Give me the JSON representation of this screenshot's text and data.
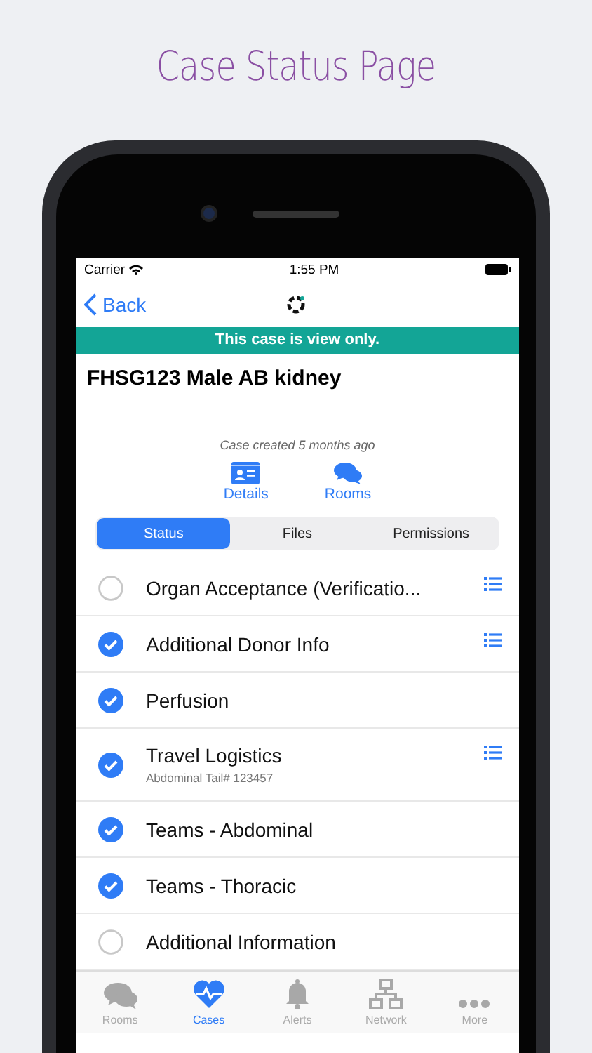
{
  "headline": "Case Status Page",
  "status_bar": {
    "carrier": "Carrier",
    "time": "1:55 PM"
  },
  "nav": {
    "back": "Back"
  },
  "banner": "This case is view only.",
  "case_title": "FHSG123 Male AB kidney",
  "created": "Case created 5 months ago",
  "actions": [
    {
      "label": "Details",
      "kind": "details"
    },
    {
      "label": "Rooms",
      "kind": "rooms"
    }
  ],
  "tabs": [
    {
      "label": "Status",
      "selected": true
    },
    {
      "label": "Files",
      "selected": false
    },
    {
      "label": "Permissions",
      "selected": false
    }
  ],
  "items": [
    {
      "label": "Organ Acceptance (Verificatio...",
      "checked": false,
      "list_button": true
    },
    {
      "label": "Additional Donor Info",
      "checked": true,
      "list_button": true
    },
    {
      "label": "Perfusion",
      "checked": true,
      "list_button": false
    },
    {
      "label": "Travel Logistics",
      "subtitle": "Abdominal Tail# 123457",
      "checked": true,
      "list_button": true
    },
    {
      "label": "Teams - Abdominal",
      "checked": true,
      "list_button": false
    },
    {
      "label": "Teams - Thoracic",
      "checked": true,
      "list_button": false
    },
    {
      "label": "Additional Information",
      "checked": false,
      "list_button": false
    }
  ],
  "tab_bar": [
    {
      "label": "Rooms",
      "kind": "rooms",
      "selected": false
    },
    {
      "label": "Cases",
      "kind": "cases",
      "selected": true
    },
    {
      "label": "Alerts",
      "kind": "alerts",
      "selected": false
    },
    {
      "label": "Network",
      "kind": "network",
      "selected": false
    },
    {
      "label": "More",
      "kind": "more",
      "selected": false
    }
  ]
}
